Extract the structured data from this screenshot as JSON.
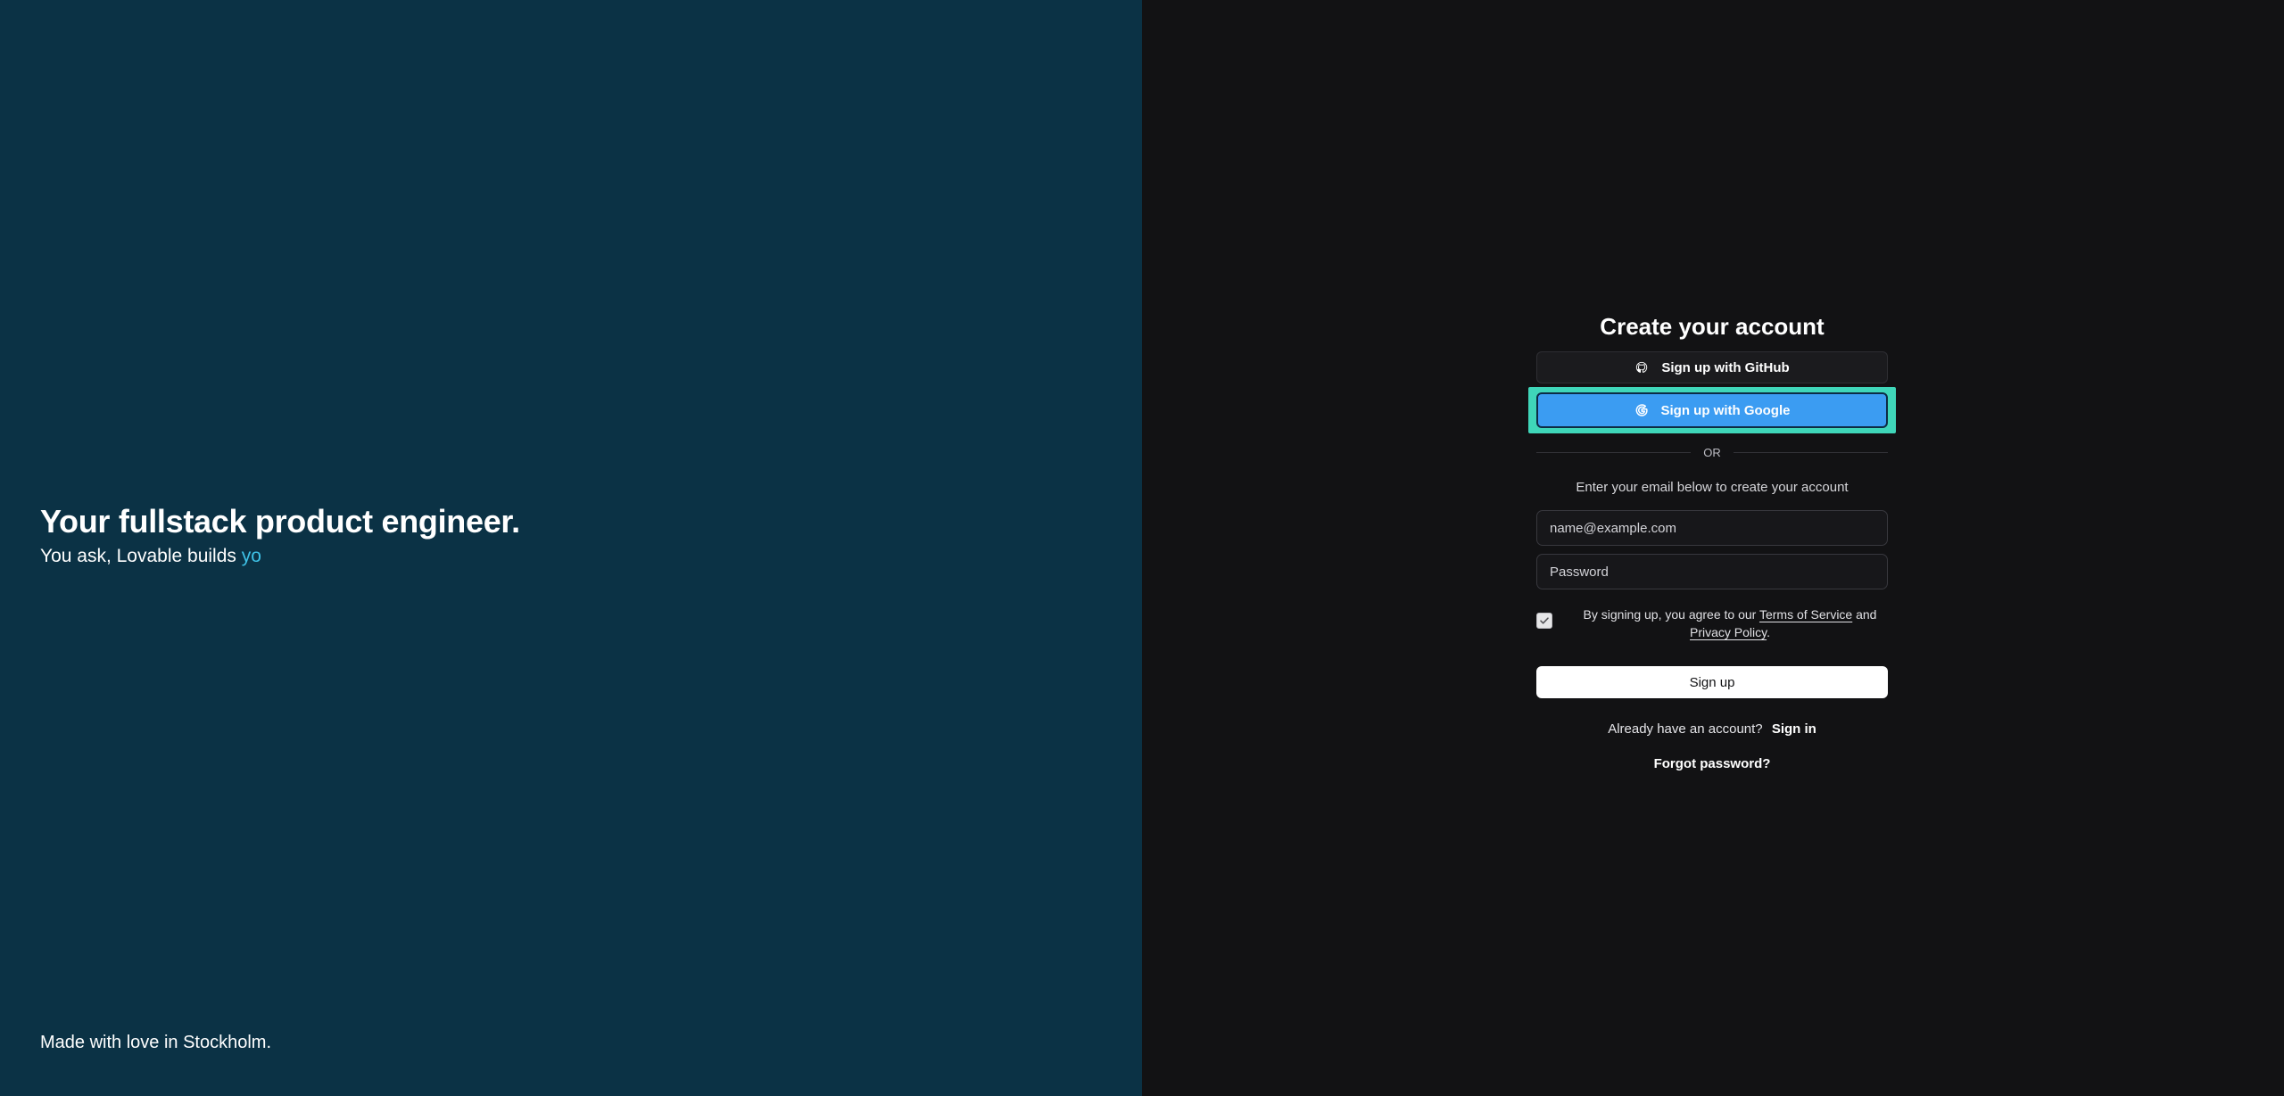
{
  "hero": {
    "title": "Your fullstack product engineer.",
    "subtitle_prefix": "You ask, Lovable builds ",
    "subtitle_typed": "yo"
  },
  "footer": {
    "note": "Made with love in Stockholm."
  },
  "auth": {
    "title": "Create your account",
    "github_button": "Sign up with GitHub",
    "google_button": "Sign up with Google",
    "divider": "OR",
    "email_hint": "Enter your email below to create your account",
    "email_placeholder": "name@example.com",
    "password_placeholder": "Password",
    "terms_prefix": "By signing up, you agree to our ",
    "terms_link": "Terms of Service",
    "terms_and": " and",
    "privacy_link": "Privacy Policy",
    "terms_suffix": ".",
    "terms_checked": true,
    "signup_button": "Sign up",
    "signin_prompt": "Already have an account?",
    "signin_link": "Sign in",
    "forgot_password": "Forgot password?"
  },
  "colors": {
    "left_background": "#0b3245",
    "right_background": "#121214",
    "accent_typed": "#3ec1e6",
    "google_button": "#3b9cf2",
    "highlight": "#3fd6b9"
  },
  "icons": {
    "github": "github-icon",
    "google": "google-icon",
    "check": "check-icon"
  }
}
